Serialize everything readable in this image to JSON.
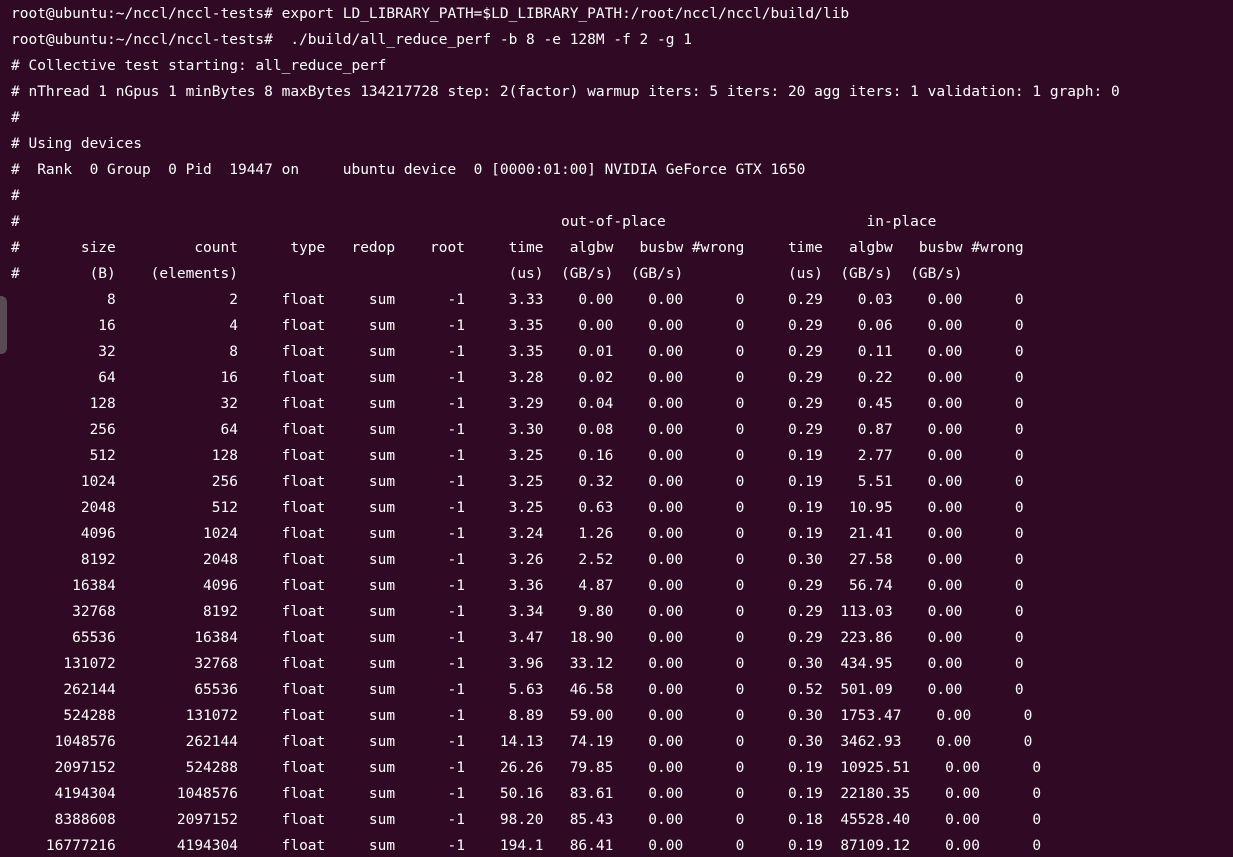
{
  "terminal": {
    "background": "#300a24",
    "foreground": "#ffffff",
    "lines": [
      "root@ubuntu:~/nccl/nccl-tests# export LD_LIBRARY_PATH=$LD_LIBRARY_PATH:/root/nccl/nccl/build/lib",
      "root@ubuntu:~/nccl/nccl-tests#  ./build/all_reduce_perf -b 8 -e 128M -f 2 -g 1",
      "# Collective test starting: all_reduce_perf",
      "# nThread 1 nGpus 1 minBytes 8 maxBytes 134217728 step: 2(factor) warmup iters: 5 iters: 20 agg iters: 1 validation: 1 graph: 0",
      "#",
      "# Using devices",
      "#  Rank  0 Group  0 Pid  19447 on     ubuntu device  0 [0000:01:00] NVIDIA GeForce GTX 1650",
      "#",
      "#                                                              out-of-place                       in-place",
      "#       size         count      type   redop    root     time   algbw   busbw #wrong     time   algbw   busbw #wrong",
      "#        (B)    (elements)                               (us)  (GB/s)  (GB/s)            (us)  (GB/s)  (GB/s)",
      "           8             2     float     sum      -1     3.33    0.00    0.00      0     0.29    0.03    0.00      0",
      "          16             4     float     sum      -1     3.35    0.00    0.00      0     0.29    0.06    0.00      0",
      "          32             8     float     sum      -1     3.35    0.01    0.00      0     0.29    0.11    0.00      0",
      "          64            16     float     sum      -1     3.28    0.02    0.00      0     0.29    0.22    0.00      0",
      "         128            32     float     sum      -1     3.29    0.04    0.00      0     0.29    0.45    0.00      0",
      "         256            64     float     sum      -1     3.30    0.08    0.00      0     0.29    0.87    0.00      0",
      "         512           128     float     sum      -1     3.25    0.16    0.00      0     0.19    2.77    0.00      0",
      "        1024           256     float     sum      -1     3.25    0.32    0.00      0     0.19    5.51    0.00      0",
      "        2048           512     float     sum      -1     3.25    0.63    0.00      0     0.19   10.95    0.00      0",
      "        4096          1024     float     sum      -1     3.24    1.26    0.00      0     0.19   21.41    0.00      0",
      "        8192          2048     float     sum      -1     3.26    2.52    0.00      0     0.30   27.58    0.00      0",
      "       16384          4096     float     sum      -1     3.36    4.87    0.00      0     0.29   56.74    0.00      0",
      "       32768          8192     float     sum      -1     3.34    9.80    0.00      0     0.29  113.03    0.00      0",
      "       65536         16384     float     sum      -1     3.47   18.90    0.00      0     0.29  223.86    0.00      0",
      "      131072         32768     float     sum      -1     3.96   33.12    0.00      0     0.30  434.95    0.00      0",
      "      262144         65536     float     sum      -1     5.63   46.58    0.00      0     0.52  501.09    0.00      0",
      "      524288        131072     float     sum      -1     8.89   59.00    0.00      0     0.30  1753.47    0.00      0",
      "     1048576        262144     float     sum      -1    14.13   74.19    0.00      0     0.30  3462.93    0.00      0",
      "     2097152        524288     float     sum      -1    26.26   79.85    0.00      0     0.19  10925.51    0.00      0",
      "     4194304       1048576     float     sum      -1    50.16   83.61    0.00      0     0.19  22180.35    0.00      0",
      "     8388608       2097152     float     sum      -1    98.20   85.43    0.00      0     0.18  45528.40    0.00      0",
      "    16777216       4194304     float     sum      -1    194.1   86.41    0.00      0     0.19  87109.12    0.00      0"
    ]
  }
}
